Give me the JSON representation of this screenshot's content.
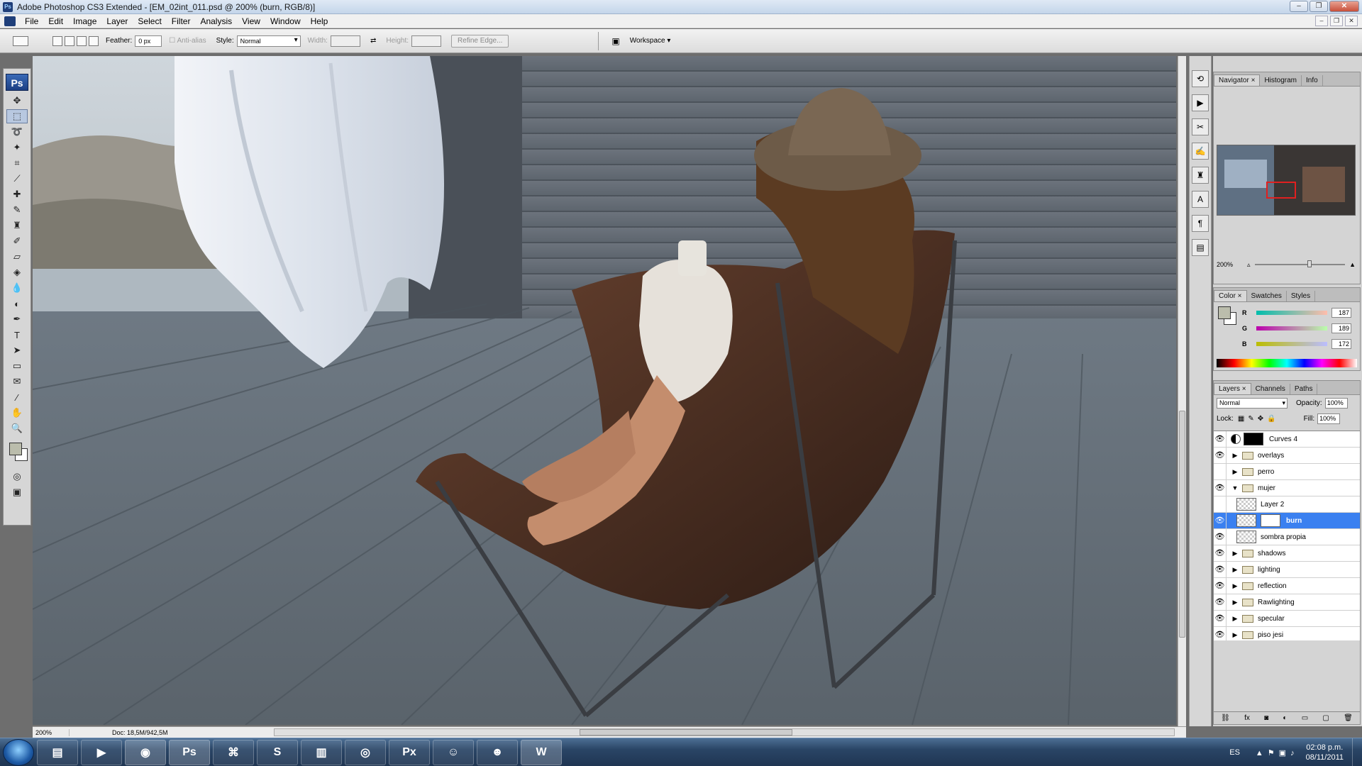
{
  "window": {
    "title": "Adobe Photoshop CS3 Extended - [EM_02int_011.psd @ 200% (burn, RGB/8)]",
    "app_icon": "Ps"
  },
  "menu": [
    "File",
    "Edit",
    "Image",
    "Layer",
    "Select",
    "Filter",
    "Analysis",
    "View",
    "Window",
    "Help"
  ],
  "options": {
    "feather_label": "Feather:",
    "feather_value": "0 px",
    "antialias_label": "Anti-alias",
    "style_label": "Style:",
    "style_value": "Normal",
    "width_label": "Width:",
    "height_label": "Height:",
    "refine_edge": "Refine Edge...",
    "workspace": "Workspace"
  },
  "toolbox": {
    "logo": "Ps"
  },
  "status": {
    "zoom": "200%",
    "doc": "Doc: 18,5M/942,5M"
  },
  "navigator": {
    "tabs": [
      "Navigator",
      "Histogram",
      "Info"
    ],
    "zoom": "200%"
  },
  "color_panel": {
    "tabs": [
      "Color",
      "Swatches",
      "Styles"
    ],
    "channels": [
      {
        "label": "R",
        "value": "187"
      },
      {
        "label": "G",
        "value": "189"
      },
      {
        "label": "B",
        "value": "172"
      }
    ],
    "foreground": "#bbbdac"
  },
  "layers_panel": {
    "tabs": [
      "Layers",
      "Channels",
      "Paths"
    ],
    "blend_mode": "Normal",
    "opacity_label": "Opacity:",
    "opacity": "100%",
    "lock_label": "Lock:",
    "fill_label": "Fill:",
    "fill": "100%",
    "layers": [
      {
        "name": "Curves 4",
        "kind": "adjustment",
        "visible": true
      },
      {
        "name": "overlays",
        "kind": "group",
        "visible": true
      },
      {
        "name": "perro",
        "kind": "group",
        "visible": false
      },
      {
        "name": "mujer",
        "kind": "group-open",
        "visible": true
      },
      {
        "name": "Layer 2",
        "kind": "layer",
        "visible": false
      },
      {
        "name": "burn",
        "kind": "layer-mask",
        "visible": true,
        "selected": true
      },
      {
        "name": "sombra propia",
        "kind": "layer",
        "visible": true
      },
      {
        "name": "shadows",
        "kind": "group",
        "visible": true
      },
      {
        "name": "lighting",
        "kind": "group",
        "visible": true
      },
      {
        "name": "reflection",
        "kind": "group",
        "visible": true
      },
      {
        "name": "Rawlighting",
        "kind": "group",
        "visible": true
      },
      {
        "name": "specular",
        "kind": "group",
        "visible": true
      },
      {
        "name": "piso jesi",
        "kind": "group",
        "visible": true
      }
    ],
    "footer_icons": [
      "link-icon",
      "fx-icon",
      "mask-icon",
      "adjustment-icon",
      "group-icon",
      "new-layer-icon",
      "trash-icon"
    ]
  },
  "taskbar": {
    "apps": [
      "explorer-icon",
      "media-player-icon",
      "firefox-icon",
      "Ps",
      "network-icon",
      "skype-icon",
      "winrar-icon",
      "app-icon",
      "Px",
      "notes-icon",
      "messenger-icon",
      "word-icon"
    ],
    "lang": "ES",
    "time": "02:08 p.m.",
    "date": "08/11/2011"
  }
}
